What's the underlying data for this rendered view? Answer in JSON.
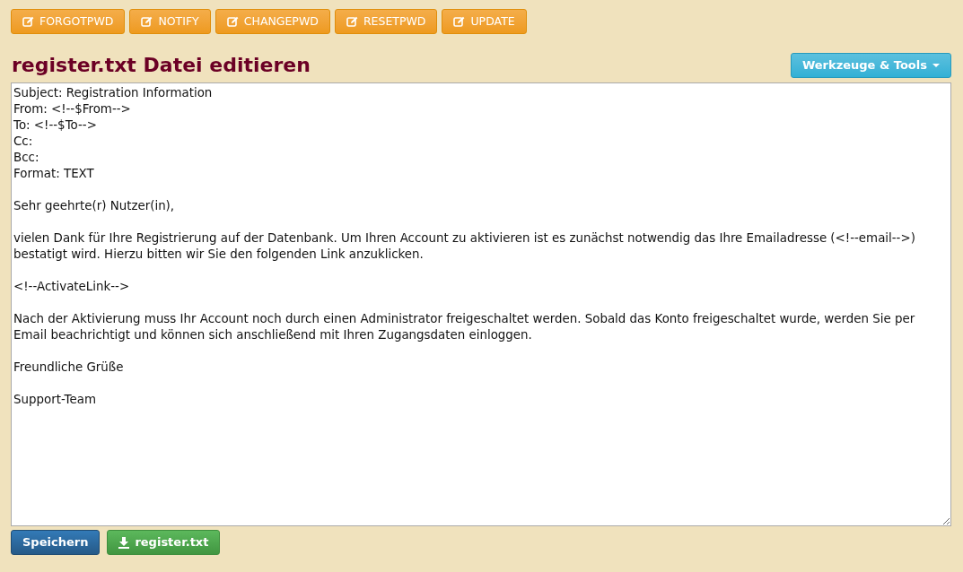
{
  "toolbar": [
    {
      "label": "FORGOTPWD"
    },
    {
      "label": "NOTIFY"
    },
    {
      "label": "CHANGEPWD"
    },
    {
      "label": "RESETPWD"
    },
    {
      "label": "UPDATE"
    }
  ],
  "title": "register.txt Datei editieren",
  "tools_button": "Werkzeuge & Tools",
  "editor": {
    "paragraphs": [
      [
        "Subject: Registration Information",
        "From: <!--$From-->",
        "To: <!--$To-->",
        "Cc:",
        "Bcc:",
        "Format: TEXT"
      ],
      [
        "Sehr geehrte(r) Nutzer(in),"
      ],
      [
        "vielen Dank für Ihre Registrierung auf der Datenbank. Um Ihren Account zu aktivieren ist es zunächst notwendig das Ihre Emailadresse (<!--email-->) bestatigt wird. Hierzu bitten wir Sie den folgenden Link anzuklicken."
      ],
      [
        "<!--ActivateLink-->"
      ],
      [
        "Nach der Aktivierung muss Ihr Account noch durch einen Administrator freigeschaltet werden. Sobald das Konto freigeschaltet wurde, werden Sie per Email beachrichtigt und können sich anschließend mit Ihren Zugangsdaten einloggen."
      ],
      [
        "Freundliche Grüße"
      ],
      [
        "Support-Team"
      ]
    ]
  },
  "footer": [
    {
      "kind": "save",
      "label": "Speichern"
    },
    {
      "kind": "download",
      "label": "register.txt"
    }
  ]
}
